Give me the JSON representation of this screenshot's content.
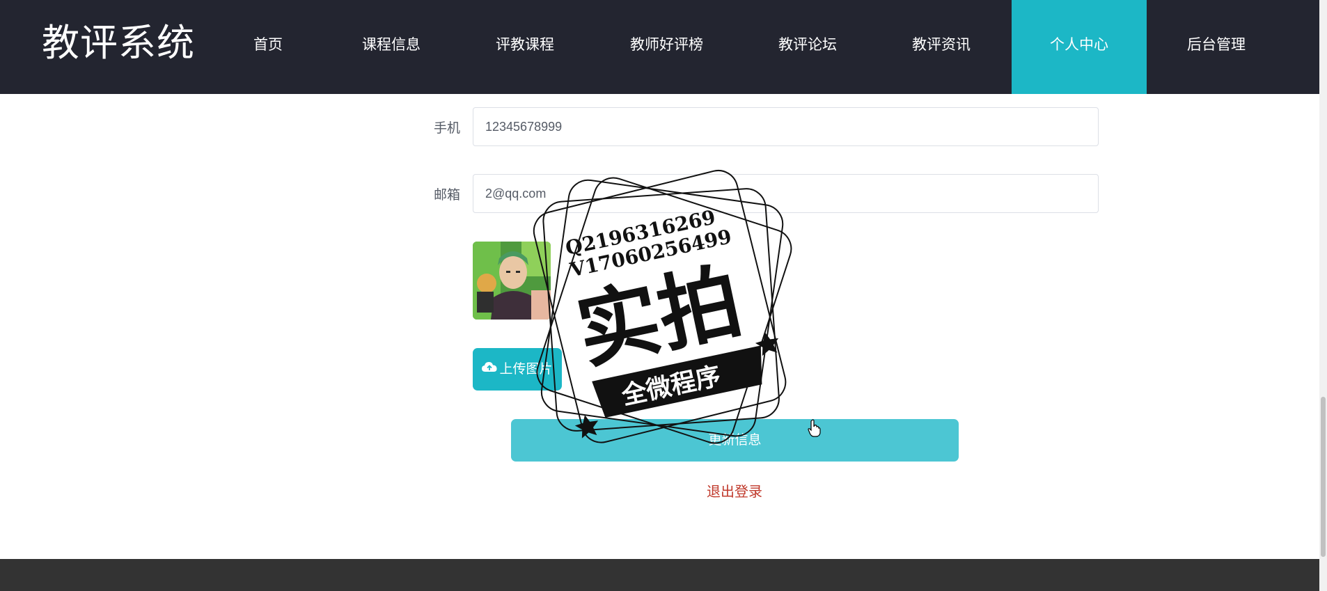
{
  "header": {
    "logo": "教评系统",
    "nav": [
      {
        "label": "首页",
        "active": false
      },
      {
        "label": "课程信息",
        "active": false
      },
      {
        "label": "评教课程",
        "active": false
      },
      {
        "label": "教师好评榜",
        "active": false
      },
      {
        "label": "教评论坛",
        "active": false
      },
      {
        "label": "教评资讯",
        "active": false
      },
      {
        "label": "个人中心",
        "active": true
      },
      {
        "label": "后台管理",
        "active": false
      }
    ],
    "active_color": "#1cb7c6",
    "background_color": "#232530"
  },
  "form": {
    "phone_label": "手机",
    "phone_value": "12345678999",
    "email_label": "邮箱",
    "email_value": "2@qq.com",
    "avatar_icon": "avatar-image",
    "upload_label": "上传图片",
    "upload_icon": "cloud-upload-icon",
    "update_label": "更新信息",
    "logout_label": "退出登录"
  },
  "watermark": {
    "line1": "Q2196316269",
    "line2": "V17060256499",
    "big": "实拍",
    "banner": "全微程序"
  }
}
